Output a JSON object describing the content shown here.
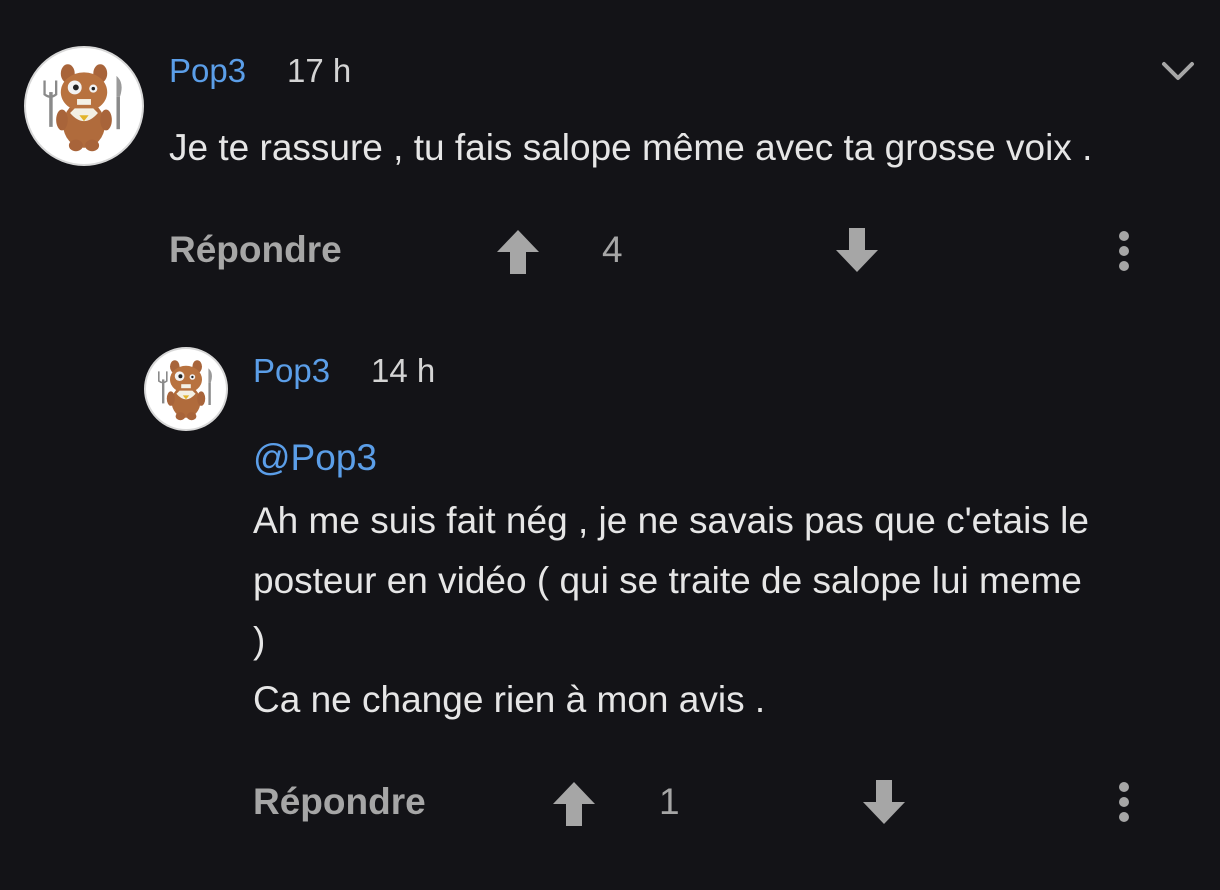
{
  "colors": {
    "background": "#131317",
    "author": "#5b9ee8",
    "text": "#e6e6e6",
    "muted": "#a6a6a6"
  },
  "comments": [
    {
      "author": "Pop3",
      "time": "17 h",
      "text": "Je te rassure , tu fais salope même avec ta grosse voix .",
      "reply_label": "Répondre",
      "votes": "4",
      "icons": [
        "avatar-image",
        "chevron-down-icon",
        "upvote-icon",
        "downvote-icon",
        "more-options-icon"
      ]
    }
  ],
  "replies": [
    {
      "author": "Pop3",
      "time": "14 h",
      "mention": "@Pop3",
      "lines": [
        "Ah me suis fait nég , je ne savais pas que c'etais le",
        "posteur en vidéo ( qui se traite de salope lui meme",
        ")",
        "Ca ne change rien à mon avis ."
      ],
      "reply_label": "Répondre",
      "votes": "1",
      "icons": [
        "avatar-image",
        "upvote-icon",
        "downvote-icon",
        "more-options-icon"
      ]
    }
  ]
}
